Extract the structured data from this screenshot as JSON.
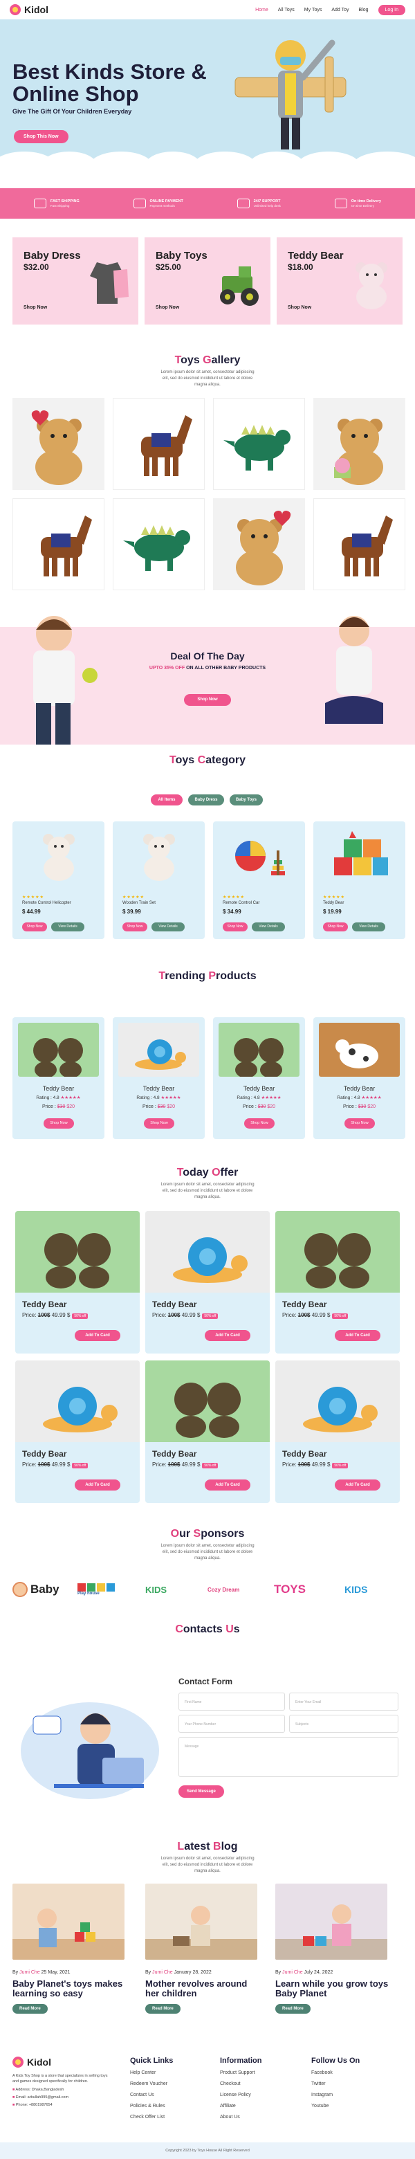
{
  "nav": {
    "brand": "Kidol",
    "items": [
      "Home",
      "All Toys",
      "My Toys",
      "Add Toy",
      "Blog"
    ],
    "login": "Log In"
  },
  "hero": {
    "title": "Best Kinds Store & Online Shop",
    "subtitle": "Give The Gift Of Your Children Everyday",
    "button": "Shop This Now"
  },
  "features": [
    {
      "title": "FAST SHIPPING",
      "sub": "Fast Shipping",
      "icon": "truck-icon"
    },
    {
      "title": "ONLINE PAYMENT",
      "sub": "Payment methods",
      "icon": "download-icon"
    },
    {
      "title": "24/7 SUPPORT",
      "sub": "Unlimited help desk",
      "icon": "headset-icon"
    },
    {
      "title": "On time Delivery",
      "sub": "On time Delivery",
      "icon": "delivery-icon"
    }
  ],
  "promo_cards": [
    {
      "name": "Baby Dress",
      "price": "$32.00",
      "link": "Shop Now"
    },
    {
      "name": "Baby Toys",
      "price": "$25.00",
      "link": "Shop Now"
    },
    {
      "name": "Teddy Bear",
      "price": "$18.00",
      "link": "Shop Now"
    }
  ],
  "gallery": {
    "title_first": "T",
    "title_rest": "oys ",
    "title_first2": "G",
    "title_rest2": "allery",
    "desc": "Lorem ipsum dolor sit amet, consectetur adipiscing elit, sed do eiusmod incididunt ut labore et dolore magna aliqua."
  },
  "deal": {
    "title": "Deal Of The Day",
    "sub_pink": "UPTO 35% OFF",
    "sub_rest": " ON ALL OTHER BABY PRODUCTS",
    "button": "Shop Now"
  },
  "category": {
    "title_first": "T",
    "title_rest": "oys ",
    "title_first2": "C",
    "title_rest2": "ategory",
    "tabs": [
      "All Items",
      "Baby Dress",
      "Baby Toys"
    ],
    "items": [
      {
        "name": "Remote Control Helicopter",
        "price": "$ 44.99"
      },
      {
        "name": "Wooden Train Set",
        "price": "$ 39.99"
      },
      {
        "name": "Remote Control Car",
        "price": "$ 34.99"
      },
      {
        "name": "Teddy Bear",
        "price": "$ 19.99"
      }
    ],
    "stars": "★★★★★",
    "shop": "Shop Now",
    "details": "View Details"
  },
  "trending": {
    "title_first": "T",
    "title_rest": "rending ",
    "title_first2": "P",
    "title_rest2": "roducts",
    "items": [
      {
        "name": "Teddy Bear",
        "rating": "Rating : 4.8",
        "old": "$30",
        "new": "$20"
      },
      {
        "name": "Teddy Bear",
        "rating": "Rating : 4.8",
        "old": "$30",
        "new": "$20"
      },
      {
        "name": "Teddy Bear",
        "rating": "Rating : 4.8",
        "old": "$30",
        "new": "$20"
      },
      {
        "name": "Teddy Bear",
        "rating": "Rating : 4.8",
        "old": "$30",
        "new": "$20"
      }
    ],
    "stars": "★★★★★",
    "price_label": "Price : ",
    "button": "Shop Now"
  },
  "offer": {
    "title_first": "T",
    "title_rest": "oday ",
    "title_first2": "O",
    "title_rest2": "ffer",
    "desc": "Lorem ipsum dolor sit amet, consectetur adipiscing elit, sed do eiusmod incididunt ut labore et dolore magna aliqua.",
    "items": [
      {
        "name": "Teddy Bear",
        "old": "100$",
        "new": "49.99 $",
        "off": "50% off"
      },
      {
        "name": "Teddy Bear",
        "old": "100$",
        "new": "49.99 $",
        "off": "50% off"
      },
      {
        "name": "Teddy Bear",
        "old": "100$",
        "new": "49.99 $",
        "off": "50% off"
      },
      {
        "name": "Teddy Bear",
        "old": "100$",
        "new": "49.99 $",
        "off": "50% off"
      },
      {
        "name": "Teddy Bear",
        "old": "100$",
        "new": "49.99 $",
        "off": "50% off"
      },
      {
        "name": "Teddy Bear",
        "old": "100$",
        "new": "49.99 $",
        "off": "50% off"
      }
    ],
    "price_label": "Price: ",
    "button": "Add To Card"
  },
  "sponsors": {
    "title_first": "O",
    "title_rest": "ur ",
    "title_first2": "S",
    "title_rest2": "ponsors",
    "desc": "Lorem ipsum dolor sit amet, consectetur adipiscing elit, sed do eiusmod incididunt ut labore et dolore magna aliqua.",
    "logos": [
      "Baby",
      "Play house",
      "KIDS",
      "Cozy Dream",
      "TOYS",
      "KIDS"
    ]
  },
  "contact": {
    "title_first": "C",
    "title_rest": "ontacts ",
    "title_first2": "U",
    "title_rest2": "s",
    "form_title": "Contact Form",
    "first_name": "First Name",
    "email": "Enter Your Email",
    "phone": "Your Phone Number",
    "subject": "Subjects",
    "message": "Message",
    "send": "Send Message"
  },
  "blog": {
    "title_first": "L",
    "title_rest": "atest ",
    "title_first2": "B",
    "title_rest2": "log",
    "desc": "Lorem ipsum dolor sit amet, consectetur adipiscing elit, sed do eiusmod incididunt ut labore et dolore magna aliqua.",
    "posts": [
      {
        "author": "Jumi Che",
        "date": "25 May, 2021",
        "title": "Baby Planet's toys makes learning so easy"
      },
      {
        "author": "Jumi Che",
        "date": "January 28, 2022",
        "title": "Mother revolves around her children"
      },
      {
        "author": "Jumi Che",
        "date": "July 24, 2022",
        "title": "Learn while you grow toys Baby Planet"
      }
    ],
    "by": "By ",
    "read": "Read More"
  },
  "footer": {
    "brand": "Kidol",
    "about": "A Kids Toy Shop is a store that specializes in selling toys and games designed specifically for children.",
    "address": "Address: Dhaka,Bangladesh",
    "email": "Email: arbullah995@gmail.com",
    "phone": "Phone: +8801987654",
    "quick_title": "Quick Links",
    "quick": [
      "Help Center",
      "Redeem Voucher",
      "Contact Us",
      "Policies & Rules",
      "Check Offer List"
    ],
    "info_title": "Information",
    "info": [
      "Product Support",
      "Checkout",
      "License Policy",
      "Affiliate",
      "About Us"
    ],
    "follow_title": "Follow Us On",
    "follow": [
      "Facebook",
      "Twitter",
      "Instagram",
      "Youtube"
    ],
    "copyright": "Copyright 2023 by Toys House All Right Reserved"
  },
  "colors": {
    "pink": "#f0548d",
    "light_blue": "#ddf0f9",
    "dark": "#1f1f3a",
    "green": "#5a8e7b"
  }
}
